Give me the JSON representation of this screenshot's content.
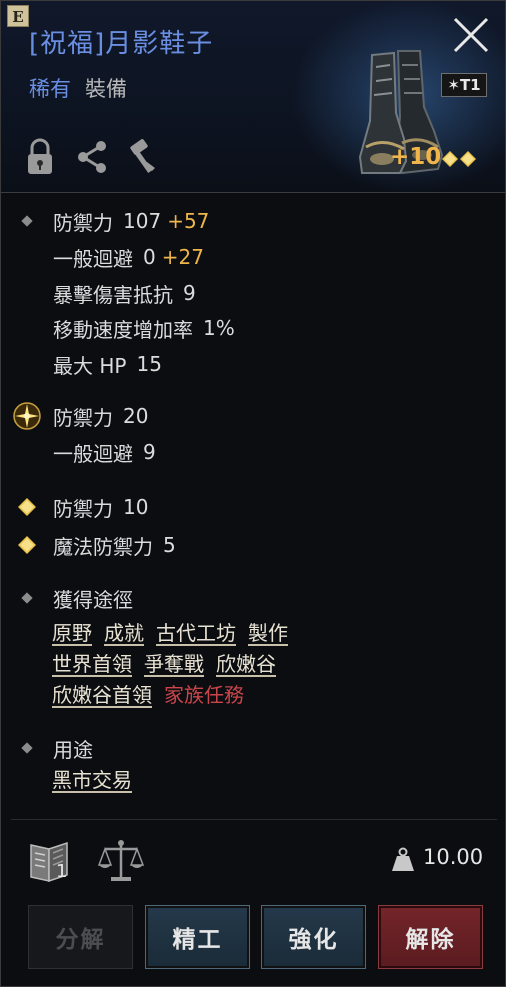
{
  "header": {
    "corner_key": "E",
    "item_name": "[祝福]月影鞋子",
    "rarity": "稀有",
    "item_type": "裝備",
    "tier_badge": "✶T1",
    "enhance_level": "+10",
    "icons": [
      "lock-icon",
      "share-icon",
      "hammer-icon",
      "close-icon",
      "boots-icon"
    ],
    "colors": {
      "name": "#6a8fe2",
      "bonus": "#f0b54a",
      "quest": "#c8454a"
    }
  },
  "base_stats": [
    {
      "label": "防禦力",
      "value": "107",
      "bonus": "+57"
    },
    {
      "label": "一般迴避",
      "value": "0",
      "bonus": "+27"
    },
    {
      "label": "暴擊傷害抵抗",
      "value": "9",
      "bonus": ""
    },
    {
      "label": "移動速度增加率",
      "value": "1%",
      "bonus": ""
    },
    {
      "label": "最大 HP",
      "value": "15",
      "bonus": ""
    }
  ],
  "blessing_stats": [
    {
      "label": "防禦力",
      "value": "20"
    },
    {
      "label": "一般迴避",
      "value": "9"
    }
  ],
  "gem_stats": [
    {
      "label": "防禦力",
      "value": "10"
    },
    {
      "label": "魔法防禦力",
      "value": "5"
    }
  ],
  "acquisition": {
    "title": "獲得途徑",
    "line1": [
      "原野",
      "成就",
      "古代工坊",
      "製作"
    ],
    "line2": [
      "世界首領",
      "爭奪戰",
      "欣嫩谷"
    ],
    "line3": [
      "欣嫩谷首領"
    ],
    "quest": "家族任務"
  },
  "usage": {
    "title": "用途",
    "items": [
      "黑市交易"
    ]
  },
  "footer": {
    "book_count": "1",
    "weight": "10.00",
    "buttons": [
      "分解",
      "精工",
      "強化",
      "解除"
    ]
  }
}
